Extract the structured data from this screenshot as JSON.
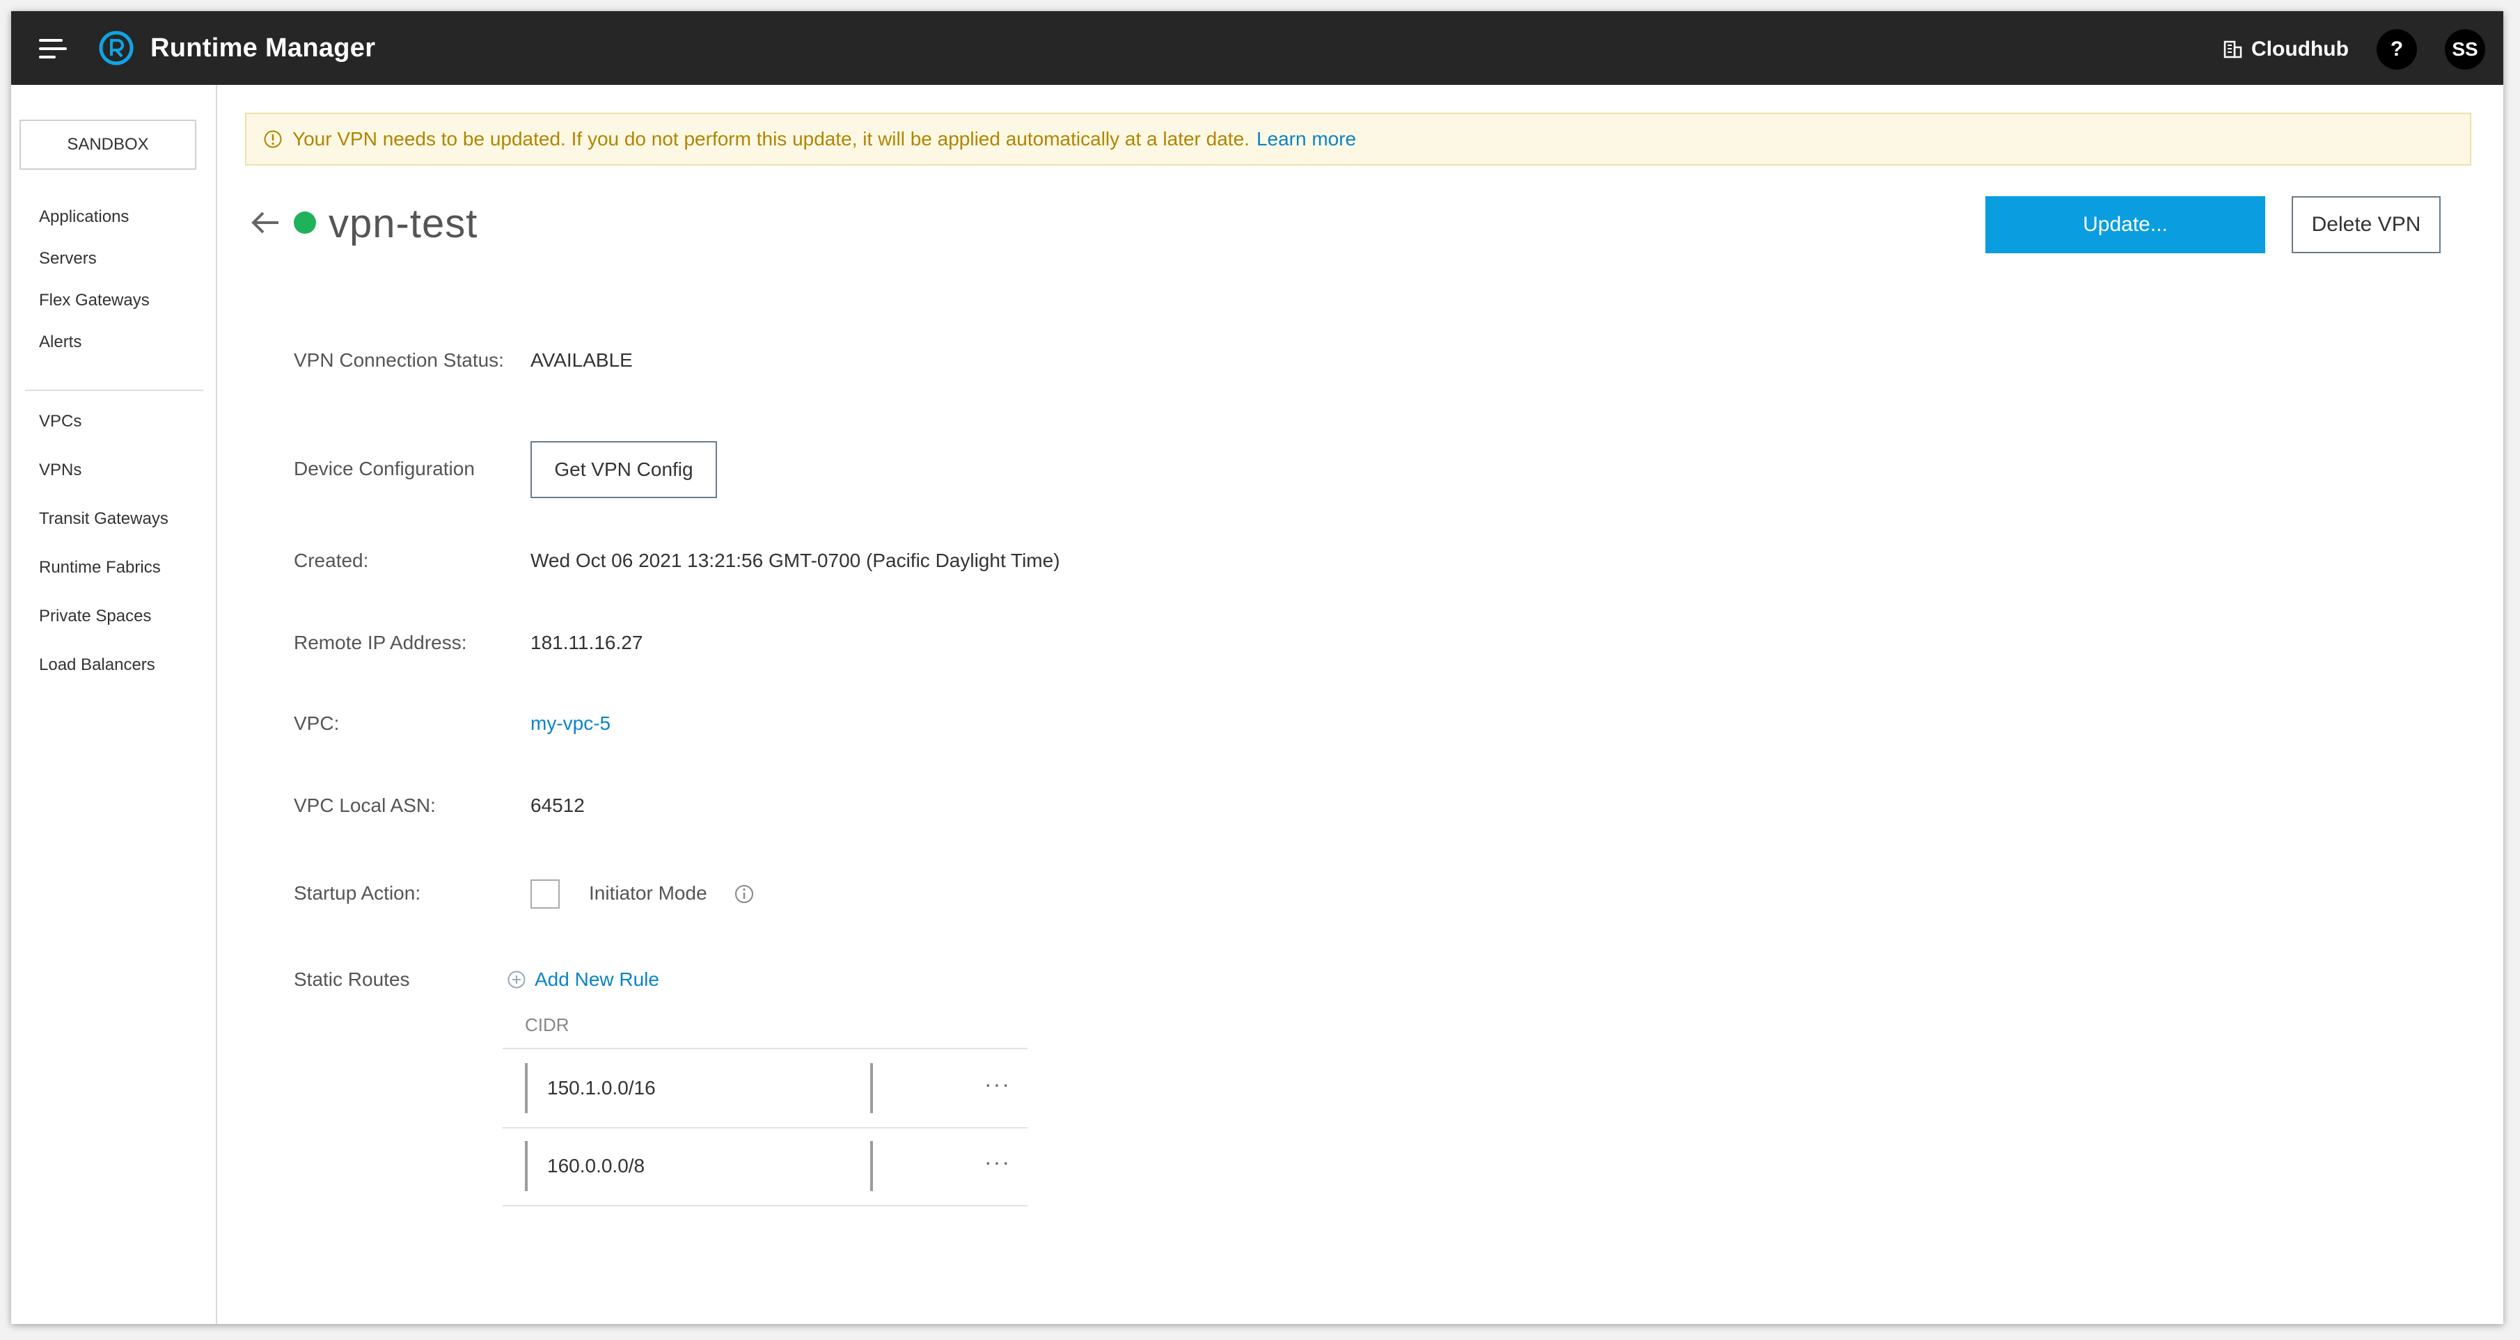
{
  "header": {
    "app_title": "Runtime Manager",
    "env_label": "Cloudhub",
    "help_label": "?",
    "user_initials": "SS"
  },
  "sidebar": {
    "env_button": "SANDBOX",
    "items": [
      {
        "label": "Applications"
      },
      {
        "label": "Servers"
      },
      {
        "label": "Flex Gateways"
      },
      {
        "label": "Alerts"
      },
      {
        "label": "VPCs"
      },
      {
        "label": "VPNs"
      },
      {
        "label": "Transit Gateways"
      },
      {
        "label": "Runtime Fabrics"
      },
      {
        "label": "Private Spaces"
      },
      {
        "label": "Load Balancers"
      }
    ]
  },
  "banner": {
    "message": "Your VPN needs to be updated. If you do not perform this update, it will be applied automatically at a later date.",
    "link": "Learn more"
  },
  "vpn": {
    "name": "vpn-test",
    "update_button": "Update...",
    "delete_button": "Delete VPN"
  },
  "details": {
    "status_label": "VPN Connection Status:",
    "status_value": "AVAILABLE",
    "device_label": "Device Configuration",
    "device_button": "Get VPN Config",
    "created_label": "Created:",
    "created_value": "Wed Oct 06 2021 13:21:56 GMT-0700 (Pacific Daylight Time)",
    "remote_ip_label": "Remote IP Address:",
    "remote_ip_value": "181.11.16.27",
    "vpc_label": "VPC:",
    "vpc_value": "my-vpc-5",
    "asn_label": "VPC Local ASN:",
    "asn_value": "64512",
    "startup_label": "Startup Action:",
    "initiator_label": "Initiator Mode",
    "static_routes_label": "Static Routes",
    "add_rule": "Add New Rule"
  },
  "routes": {
    "column_header": "CIDR",
    "rows": [
      {
        "cidr": "150.1.0.0/16",
        "more": "···"
      },
      {
        "cidr": "160.0.0.0/8",
        "more": "···"
      }
    ]
  },
  "colors": {
    "topbar": "#262626",
    "accent": "#0a9ee0",
    "status_ok": "#1fb25a",
    "banner_bg": "#fdf8e4",
    "banner_text": "#b08500",
    "link": "#0a84c6"
  }
}
